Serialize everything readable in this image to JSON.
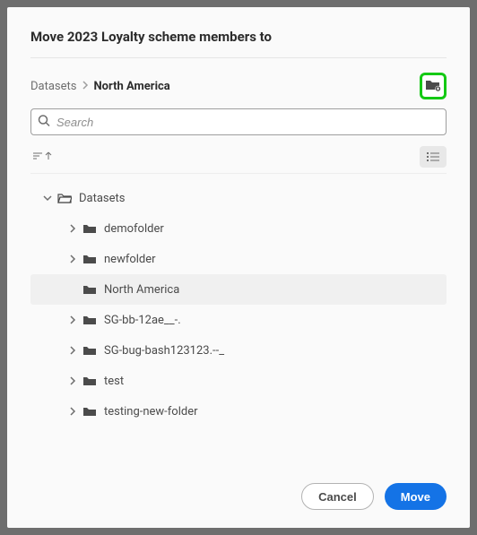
{
  "title": "Move 2023 Loyalty scheme members to",
  "breadcrumb": {
    "root": "Datasets",
    "current": "North America"
  },
  "search": {
    "placeholder": "Search"
  },
  "tree": {
    "root": {
      "label": "Datasets",
      "expanded": true
    },
    "items": [
      {
        "label": "demofolder",
        "selected": false
      },
      {
        "label": "newfolder",
        "selected": false
      },
      {
        "label": "North America",
        "selected": true
      },
      {
        "label": "SG-bb-12ae__-.",
        "selected": false
      },
      {
        "label": "SG-bug-bash123123.--_",
        "selected": false
      },
      {
        "label": "test",
        "selected": false
      },
      {
        "label": "testing-new-folder",
        "selected": false
      }
    ]
  },
  "buttons": {
    "cancel": "Cancel",
    "move": "Move"
  }
}
